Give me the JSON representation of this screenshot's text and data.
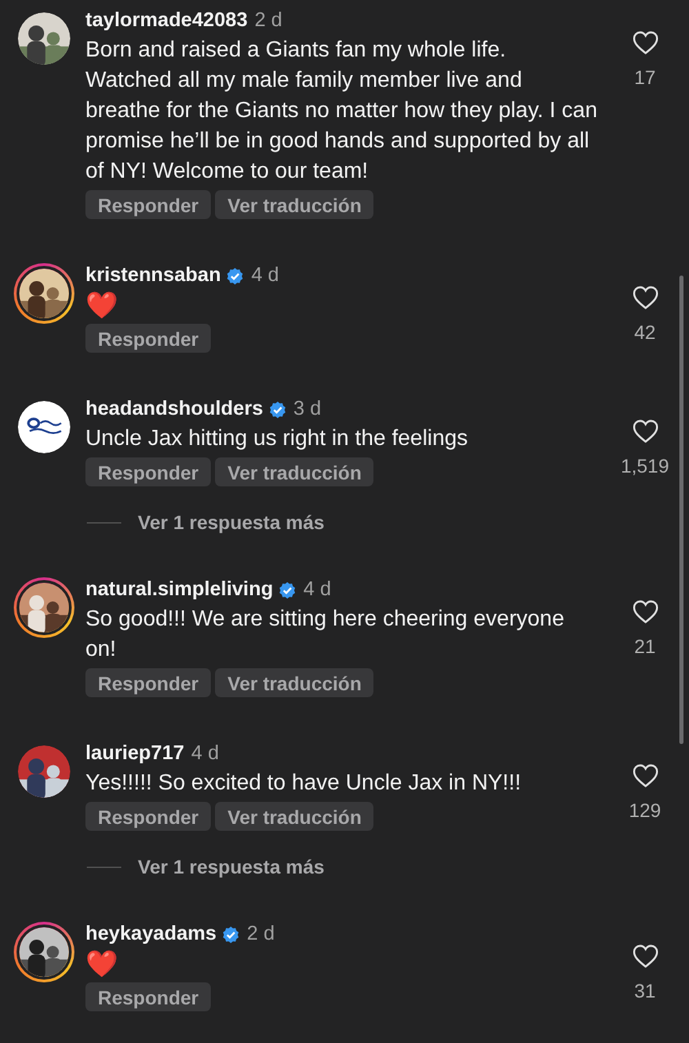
{
  "comments": [
    {
      "username": "taylormade42083",
      "verified": false,
      "story_ring": false,
      "avatar": {
        "kind": "picture"
      },
      "time": "2 d",
      "text": "Born and raised a Giants fan my whole life.  Watched all my male family member live and breathe for the Giants no matter how they play.  I can promise he’ll be in good hands and supported by all of NY!  Welcome to our team!",
      "actions": [
        "Responder",
        "Ver traducción"
      ],
      "likes": "17",
      "emoji": false
    },
    {
      "username": "kristennsaban",
      "verified": true,
      "story_ring": true,
      "avatar": {
        "kind": "picture"
      },
      "time": "4 d",
      "text": "❤️",
      "actions": [
        "Responder"
      ],
      "likes": "42",
      "emoji": true
    },
    {
      "username": "headandshoulders",
      "verified": true,
      "story_ring": false,
      "avatar": {
        "kind": "logo"
      },
      "time": "3 d",
      "text": "Uncle Jax hitting us right in the feelings",
      "actions": [
        "Responder",
        "Ver traducción"
      ],
      "likes": "1,519",
      "emoji": false,
      "more_replies": "Ver 1 respuesta más"
    },
    {
      "username": "natural.simpleliving",
      "verified": true,
      "story_ring": true,
      "avatar": {
        "kind": "picture"
      },
      "time": "4 d",
      "text": "So good!!! We are sitting here cheering everyone on!",
      "actions": [
        "Responder",
        "Ver traducción"
      ],
      "likes": "21",
      "emoji": false
    },
    {
      "username": "lauriep717",
      "verified": false,
      "story_ring": false,
      "avatar": {
        "kind": "picture"
      },
      "time": "4 d",
      "text": "Yes!!!!! So excited to have Uncle Jax in NY!!!",
      "actions": [
        "Responder",
        "Ver traducción"
      ],
      "likes": "129",
      "emoji": false,
      "more_replies": "Ver 1 respuesta más"
    },
    {
      "username": "heykayadams",
      "verified": true,
      "story_ring": true,
      "avatar": {
        "kind": "picture"
      },
      "time": "2 d",
      "text": "❤️",
      "actions": [
        "Responder"
      ],
      "likes": "31",
      "emoji": true
    }
  ]
}
